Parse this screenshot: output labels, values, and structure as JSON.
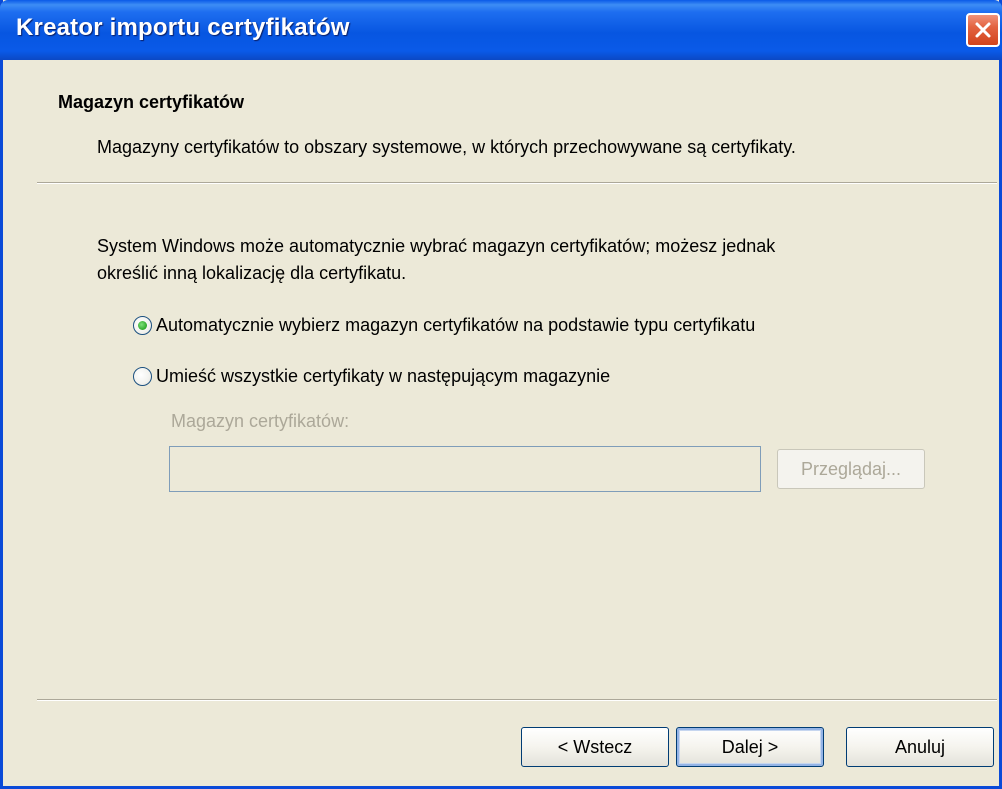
{
  "window": {
    "title": "Kreator importu certyfikatów"
  },
  "header": {
    "title": "Magazyn certyfikatów",
    "description": "Magazyny certyfikatów to obszary systemowe, w których przechowywane są certyfikaty."
  },
  "body": {
    "intro_line1": "System Windows może automatycznie wybrać magazyn certyfikatów; możesz jednak",
    "intro_line2": "określić inną lokalizację dla certyfikatu.",
    "option_auto": "Automatycznie wybierz magazyn certyfikatów na podstawie typu certyfikatu",
    "option_manual": "Umieść wszystkie certyfikaty w następującym magazynie",
    "store_label": "Magazyn certyfikatów:",
    "store_value": "",
    "browse_label": "Przeglądaj..."
  },
  "buttons": {
    "back": "< Wstecz",
    "next": "Dalej >",
    "cancel": "Anuluj"
  },
  "colors": {
    "titlebar": "#0a5ae8",
    "background": "#ece9d8",
    "disabled_text": "#aca899"
  },
  "icons": {
    "close": "close-icon"
  }
}
